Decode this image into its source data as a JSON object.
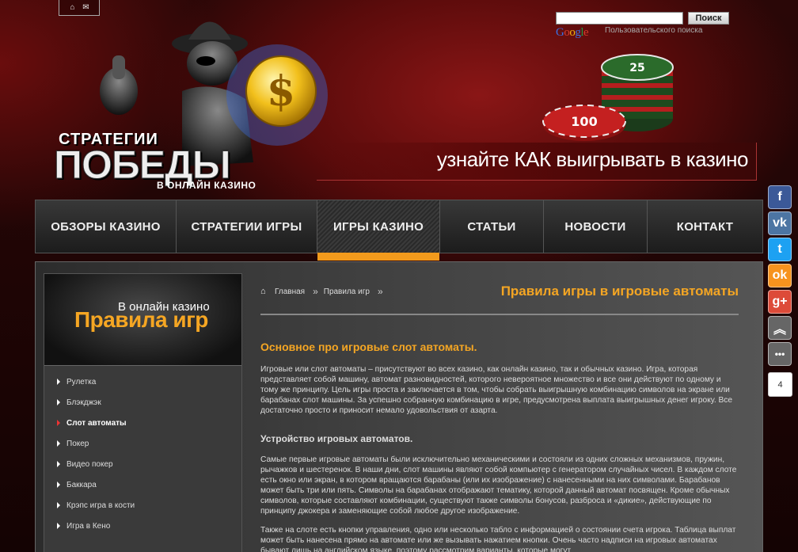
{
  "header": {
    "top_icons": [
      "home-icon",
      "mail-icon"
    ],
    "search": {
      "placeholder": "",
      "button_label": "Поиск",
      "google_label": "Google",
      "custom_search_label": "Пользовательского поиска"
    },
    "logo": {
      "line1": "СТРАТЕГИИ",
      "line2": "ПОБЕДЫ",
      "line3": "В ОНЛАЙН КАЗИНО"
    },
    "tagline": "узнайте КАК выигрывать в казино"
  },
  "nav": {
    "items": [
      {
        "label": "ОБЗОРЫ КАЗИНО"
      },
      {
        "label": "СТРАТЕГИИ ИГРЫ"
      },
      {
        "label": "ИГРЫ КАЗИНО"
      },
      {
        "label": "СТАТЬИ"
      },
      {
        "label": "НОВОСТИ"
      },
      {
        "label": "КОНТАКТ"
      }
    ],
    "active_index": 2,
    "accent_color": "#f29a1c"
  },
  "sidebar": {
    "header_small": "В онлайн казино",
    "header_big": "Правила игр",
    "items": [
      {
        "label": "Рулетка"
      },
      {
        "label": "Блэкджэк"
      },
      {
        "label": "Слот автоматы"
      },
      {
        "label": "Покер"
      },
      {
        "label": "Видео покер"
      },
      {
        "label": "Баккара"
      },
      {
        "label": "Крэпс игра в кости"
      },
      {
        "label": "Игра в Кено"
      }
    ],
    "active_index": 2
  },
  "content": {
    "breadcrumb": [
      "Главная",
      "Правила игр"
    ],
    "page_title": "Правила игры в игровые автоматы",
    "heading": "Основное про игровые слот автоматы.",
    "paragraph1": "Игровые или слот автоматы – присутствуют во всех казино, как онлайн казино, так и обычных казино. Игра, которая представляет собой машину, автомат разновидностей, которого невероятное множество и все они действуют по одному и тому же принципу. Цель игры проста и заключается в том, чтобы собрать выигрышную комбинацию символов на экране или барабанах слот машины. За успешно собранную комбинацию в игре, предусмотрена выплата выигрышных денег игроку. Все достаточно просто и приносит немало удовольствия от азарта.",
    "subheading": "Устройство игровых автоматов.",
    "paragraph2": "Самые первые игровые автоматы были исключительно механическими и состояли из одних сложных механизмов, пружин, рычажков и шестеренок. В наши дни, слот машины являют собой компьютер с генератором случайных чисел. В каждом слоте есть окно или экран, в котором вращаются барабаны (или их изображение) с нанесенными на них символами. Барабанов может быть три или пять. Символы на барабанах отображают тематику, которой данный автомат посвящен. Кроме обычных символов, которые составляют комбинации, существуют также символы бонусов, разброса и «дикие», действующие по принципу джокера и заменяющие собой любое другое изображение.",
    "paragraph3": "Также на слоте есть кнопки управления, одно или несколько табло с информацией о состоянии счета игрока. Таблица выплат может быть нанесена прямо на автомате или же вызывать нажатием кнопки. Очень часто надписи на игровых автоматах бывают лишь на английском языке, поэтому рассмотрим варианты, которые могут"
  },
  "social": {
    "buttons": [
      {
        "icon": "facebook-icon",
        "glyph": "f",
        "color": "#3b5998"
      },
      {
        "icon": "vk-icon",
        "glyph": "vk",
        "color": "#4c75a3"
      },
      {
        "icon": "twitter-icon",
        "glyph": "t",
        "color": "#1da1f2"
      },
      {
        "icon": "odnoklassniki-icon",
        "glyph": "ok",
        "color": "#f7931e"
      },
      {
        "icon": "google-plus-icon",
        "glyph": "g+",
        "color": "#dd4b39"
      },
      {
        "icon": "scroll-up-icon",
        "glyph": "︽",
        "color": "#666666"
      },
      {
        "icon": "more-icon",
        "glyph": "•••",
        "color": "#666666"
      }
    ],
    "counter": "4"
  }
}
